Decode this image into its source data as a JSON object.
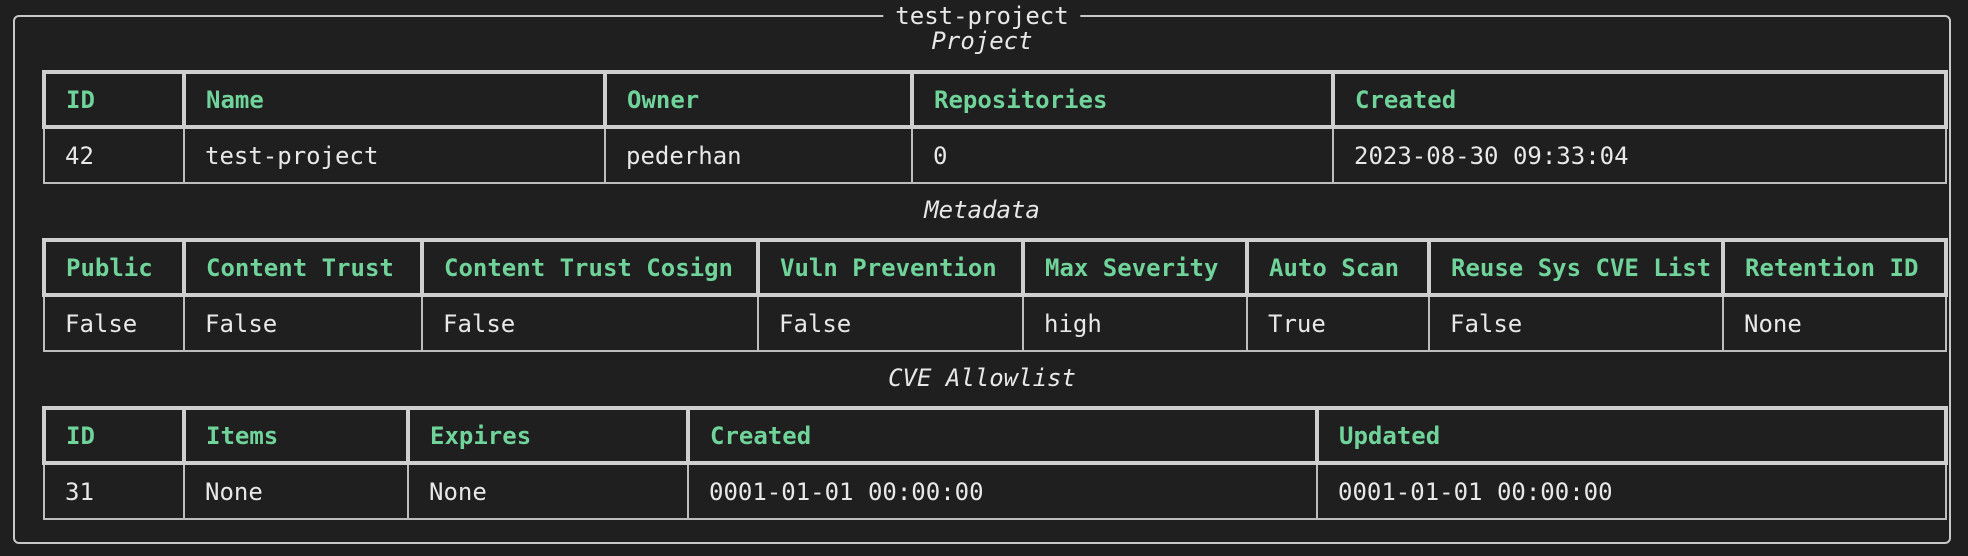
{
  "panel": {
    "title": "test-project"
  },
  "project": {
    "section_title": "Project",
    "headers": [
      "ID",
      "Name",
      "Owner",
      "Repositories",
      "Created"
    ],
    "row": [
      "42",
      "test-project",
      "pederhan",
      "0",
      "2023-08-30 09:33:04"
    ]
  },
  "metadata": {
    "section_title": "Metadata",
    "headers": [
      "Public",
      "Content Trust",
      "Content Trust Cosign",
      "Vuln Prevention",
      "Max Severity",
      "Auto Scan",
      "Reuse Sys CVE List",
      "Retention ID"
    ],
    "row": [
      "False",
      "False",
      "False",
      "False",
      "high",
      "True",
      "False",
      "None"
    ]
  },
  "cve_allowlist": {
    "section_title": "CVE Allowlist",
    "headers": [
      "ID",
      "Items",
      "Expires",
      "Created",
      "Updated"
    ],
    "row": [
      "31",
      "None",
      "None",
      "0001-01-01 00:00:00",
      "0001-01-01 00:00:00"
    ]
  },
  "colors": {
    "background": "#1f1f1f",
    "header_text": "#6fd39a",
    "cell_text": "#e8e8e8",
    "border": "#c8c8c8"
  }
}
